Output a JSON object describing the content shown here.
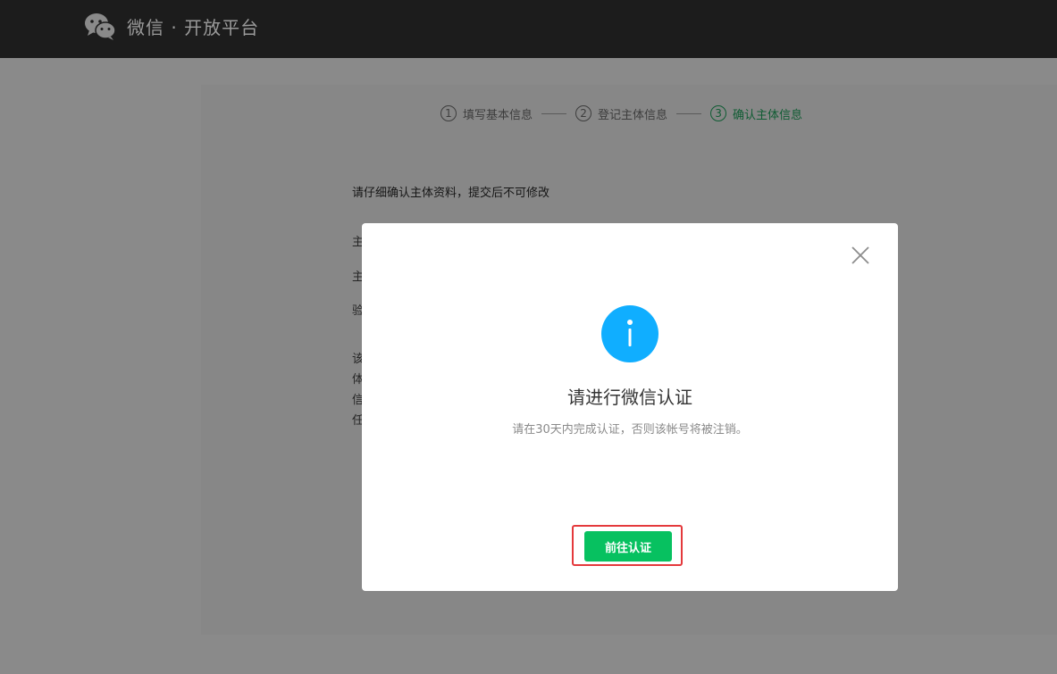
{
  "header": {
    "logo_text": "微信 · 开放平台"
  },
  "steps": [
    {
      "num": "1",
      "label": "填写基本信息"
    },
    {
      "num": "2",
      "label": "登记主体信息"
    },
    {
      "num": "3",
      "label": "确认主体信息"
    }
  ],
  "main": {
    "notice": "请仔细确认主体资料，提交后不可修改",
    "fields": [
      "主",
      "主",
      "验"
    ],
    "paragraph": [
      "该",
      "体",
      "信",
      "任"
    ]
  },
  "modal": {
    "title": "请进行微信认证",
    "description": "请在30天内完成认证，否则该帐号将被注销。",
    "button_label": "前往认证"
  },
  "colors": {
    "accent_green": "#07c160",
    "info_blue": "#10aeff",
    "highlight_red": "#e4393c"
  }
}
